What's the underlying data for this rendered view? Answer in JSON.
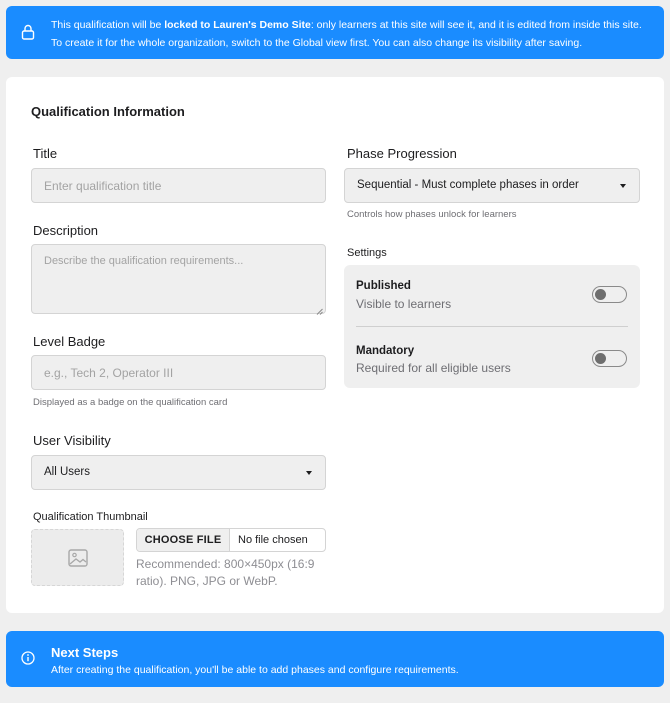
{
  "top_notice": {
    "prefix": "This qualification will be ",
    "locked_text": "locked to Lauren's Demo Site",
    "suffix": ": only learners at this site will see it, and it is edited from inside this site.",
    "line2": "To create it for the whole organization, switch to the Global view first. You can also change its visibility after saving."
  },
  "form": {
    "section_title": "Qualification Information",
    "title": {
      "label": "Title",
      "placeholder": "Enter qualification title"
    },
    "description": {
      "label": "Description",
      "placeholder": "Describe the qualification requirements..."
    },
    "level_badge": {
      "label": "Level Badge",
      "placeholder": "e.g., Tech 2, Operator III",
      "help": "Displayed as a badge on the qualification card"
    },
    "user_visibility": {
      "label": "User Visibility",
      "value": "All Users"
    },
    "thumbnail": {
      "label": "Qualification Thumbnail",
      "choose_label": "CHOOSE FILE",
      "no_file": "No file chosen",
      "recommendation": "Recommended: 800×450px (16:9 ratio). PNG, JPG or WebP."
    },
    "phase_progression": {
      "label": "Phase Progression",
      "value": "Sequential - Must complete phases in order",
      "help": "Controls how phases unlock for learners"
    },
    "settings": {
      "label": "Settings",
      "published": {
        "title": "Published",
        "desc": "Visible to learners",
        "on": false
      },
      "mandatory": {
        "title": "Mandatory",
        "desc": "Required for all eligible users",
        "on": false
      }
    }
  },
  "next_steps": {
    "title": "Next Steps",
    "desc": "After creating the qualification, you'll be able to add phases and configure requirements."
  },
  "colors": {
    "accent": "#1a8cff",
    "field_bg": "#efefef",
    "page_bg": "#efefef"
  }
}
